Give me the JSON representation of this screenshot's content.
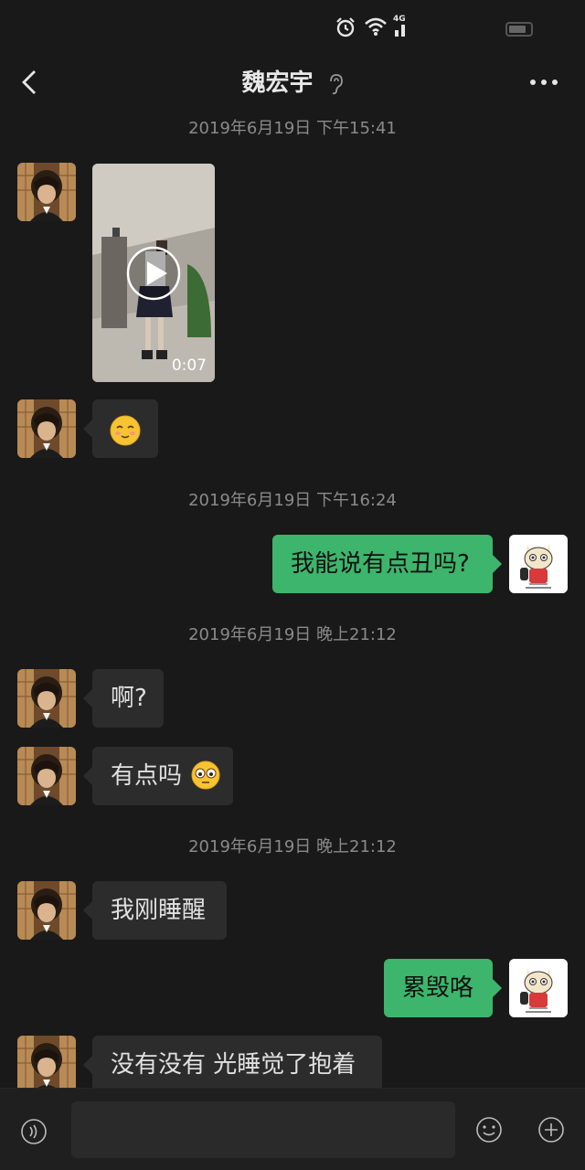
{
  "status_bar": {
    "icons": [
      "alarm-icon",
      "wifi-icon",
      "cellular-4g-icon",
      "battery-icon"
    ],
    "network_label": "4G"
  },
  "nav": {
    "title": "魏宏宇",
    "back_icon": "chevron-left-icon",
    "title_icon": "ear-icon",
    "more_icon": "more-dots-icon"
  },
  "messages": {
    "ts1": "2019年6月19日 下午15:41",
    "video_duration": "0:07",
    "ts2": "2019年6月19日 下午16:24",
    "msg_ugly": "我能说有点丑吗?",
    "ts3": "2019年6月19日 晚上21:12",
    "msg_ah": "啊?",
    "msg_a_bit": "有点吗",
    "ts4": "2019年6月19日 晚上21:12",
    "msg_woke": "我刚睡醒",
    "msg_ruined": "累毁咯",
    "msg_no": "没有没有 光睡觉了抱着"
  },
  "colors": {
    "background": "#191919",
    "sent_bubble": "#3db56c",
    "received_bubble": "#2c2c2c",
    "timestamp": "#8a8a8a"
  },
  "input_bar": {
    "placeholder": "",
    "icons": [
      "voice-icon",
      "emoji-icon",
      "plus-icon"
    ]
  }
}
